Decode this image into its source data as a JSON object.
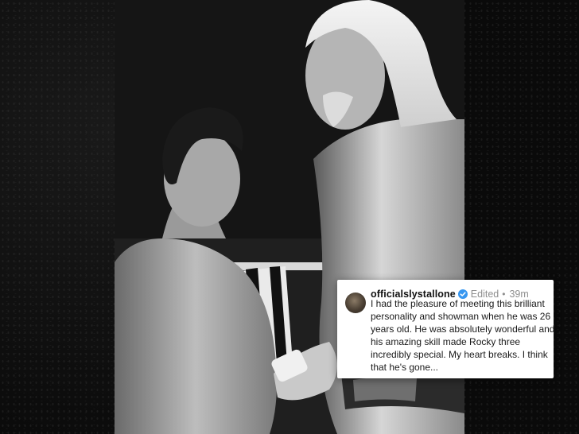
{
  "post": {
    "username": "officialslystallone",
    "edited_label": "Edited",
    "separator": "•",
    "time": "39m",
    "caption": "I had the pleasure of meeting this brilliant personality and showman when he was 26 years old. He was absolutely wonderful and his amazing skill made Rocky three incredibly special. My heart breaks. I think that he's gone...",
    "verified_icon": "verified-badge-icon"
  },
  "colors": {
    "verified_blue": "#3897f0",
    "meta_gray": "#8e8e8e",
    "card_bg": "#ffffff"
  }
}
